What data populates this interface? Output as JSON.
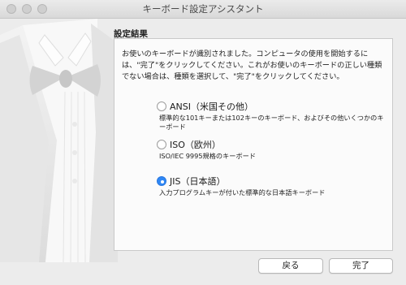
{
  "window": {
    "title": "キーボード設定アシスタント"
  },
  "section_title": "設定結果",
  "description": "お使いのキーボードが識別されました。コンピュータの使用を開始するには、\"完了\"をクリックしてください。これがお使いのキーボードの正しい種類でない場合は、種類を選択して、\"完了\"をクリックしてください。",
  "options": [
    {
      "label": "ANSI（米国その他）",
      "description": "標準的な101キーまたは102キーのキーボード、およびその他いくつかのキーボード",
      "selected": false
    },
    {
      "label": "ISO（欧州）",
      "description": "ISO/IEC 9995規格のキーボード",
      "selected": false
    },
    {
      "label": "JIS（日本語）",
      "description": "入力プログラムキーが付いた標準的な日本語キーボード",
      "selected": true
    }
  ],
  "buttons": {
    "back": "戻る",
    "done": "完了"
  },
  "colors": {
    "accent": "#2f87f5",
    "window_bg": "#ececec"
  }
}
